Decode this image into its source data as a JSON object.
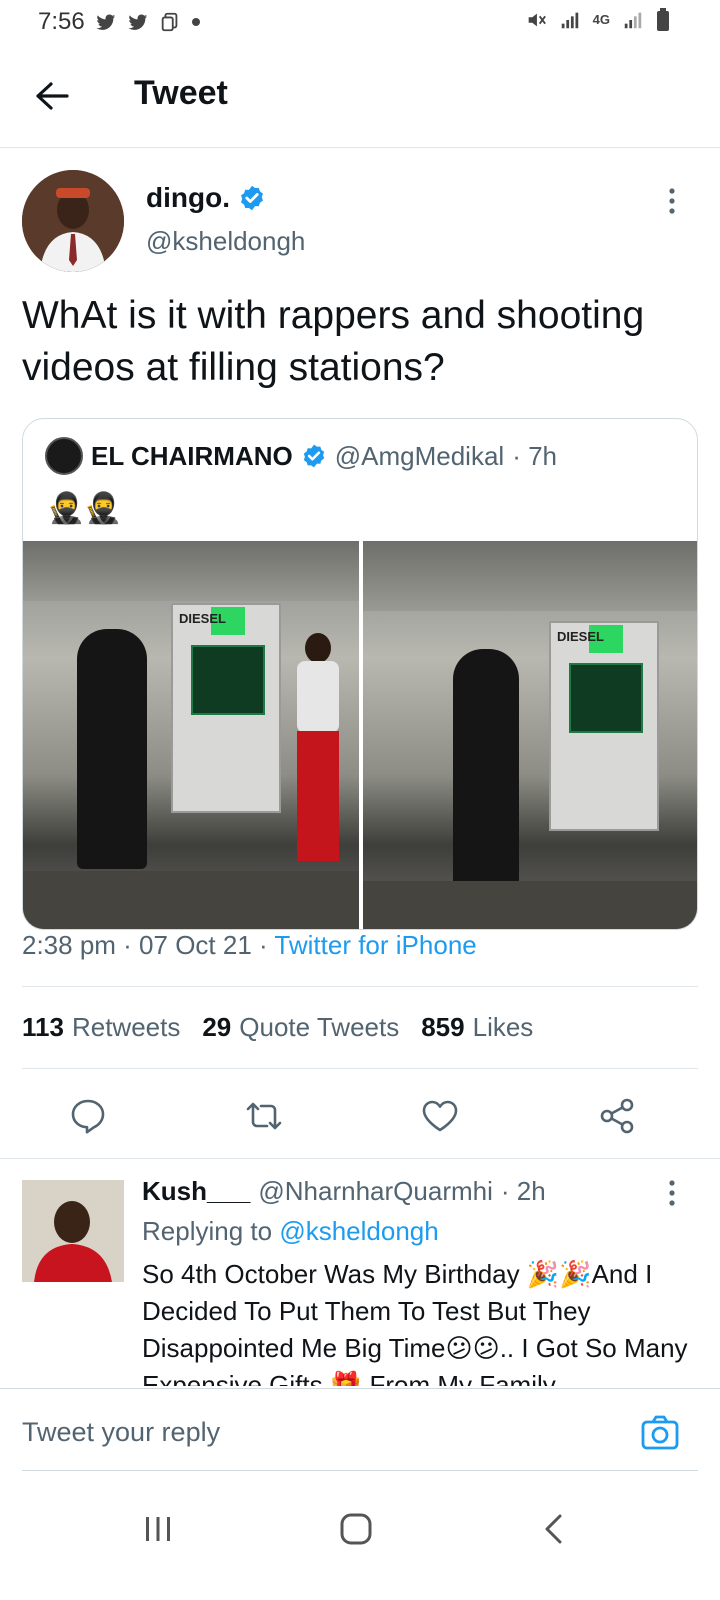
{
  "status_bar": {
    "time": "7:56",
    "network": "4G"
  },
  "header": {
    "title": "Tweet"
  },
  "tweet": {
    "author_name": "dingo.",
    "author_handle": "@ksheldongh",
    "text": "WhAt is it with rappers and shooting videos at filling stations?",
    "timestamp": "2:38 pm · 07 Oct 21 · ",
    "source": "Twitter for iPhone",
    "stats": {
      "retweets": "113",
      "retweets_label": "Retweets",
      "quotes": "29",
      "quotes_label": "Quote Tweets",
      "likes": "859",
      "likes_label": "Likes"
    }
  },
  "quoted_tweet": {
    "author_name": "EL CHAIRMANO",
    "author_handle": "@AmgMedikal",
    "time": "· 7h",
    "text": "🥷🥷",
    "image_labels": [
      "DIESEL",
      "DIESEL"
    ]
  },
  "reply": {
    "author_name": "Kush___",
    "author_handle": "@NharnharQuarmhi",
    "time": "· 2h",
    "replying_prefix": "Replying to ",
    "replying_to": "@ksheldongh",
    "text": "So 4th October Was My Birthday 🎉🎉And I Decided To Put Them To Test  But They Disappointed Me Big Time😕😕.. I Got So Many Expensive Gifts 🎁 From My Family"
  },
  "composer": {
    "placeholder": "Tweet your reply"
  },
  "colors": {
    "accent": "#1d9bf0",
    "text": "#0f1419",
    "secondary": "#536471"
  },
  "icons": [
    "back-arrow-icon",
    "verified-icon",
    "more-icon",
    "reply-icon",
    "retweet-icon",
    "like-icon",
    "share-icon",
    "camera-icon",
    "recents-icon",
    "home-icon",
    "back-icon"
  ]
}
